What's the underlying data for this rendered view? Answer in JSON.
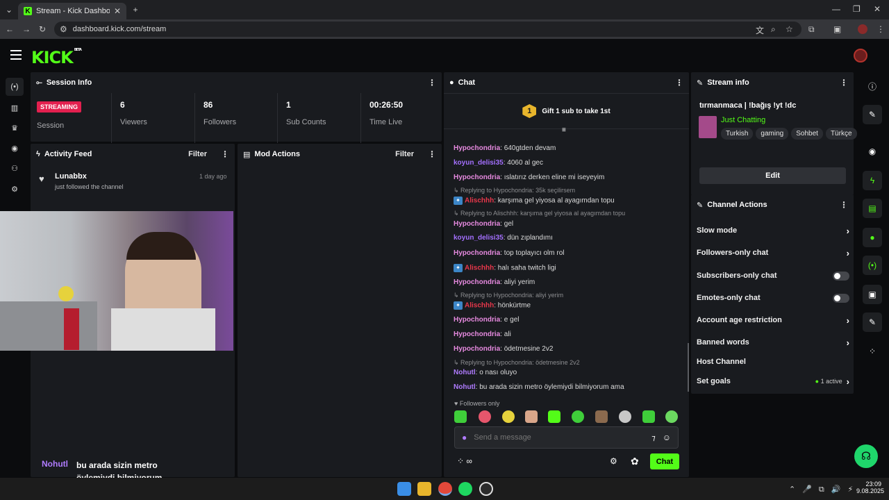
{
  "browser": {
    "tab_title": "Stream - Kick Dashboard",
    "url": "dashboard.kick.com/stream"
  },
  "header": {
    "logo": "KICK",
    "logo_badge": "BETA"
  },
  "session": {
    "title": "Session Info",
    "status_badge": "STREAMING",
    "session_label": "Session",
    "stats": [
      {
        "value": "6",
        "label": "Viewers"
      },
      {
        "value": "86",
        "label": "Followers"
      },
      {
        "value": "1",
        "label": "Sub Counts"
      },
      {
        "value": "00:26:50",
        "label": "Time Live"
      }
    ]
  },
  "activity": {
    "title": "Activity Feed",
    "filter": "Filter",
    "items": [
      {
        "user": "Lunabbx",
        "time": "1 day ago",
        "text": "just followed the channel"
      }
    ]
  },
  "mod": {
    "title": "Mod Actions",
    "filter": "Filter"
  },
  "chat": {
    "title": "Chat",
    "gift_number": "1",
    "gift_text": "Gift 1 sub to take 1st",
    "messages": [
      {
        "user": "Hypochondria",
        "text": "640gtden devam",
        "color": "#e78ae0"
      },
      {
        "user": "koyun_delisi35",
        "text": "4060 al gec",
        "color": "#a470ff"
      },
      {
        "user": "Hypochondria",
        "text": "ıslatırız derken eline mi iseyeyim",
        "color": "#e78ae0"
      },
      {
        "reply": "Replying to Hypochondria: 35k seçilirsem"
      },
      {
        "user": "Alischhh",
        "text": "karşıma gel yiyosa al ayagımdan topu",
        "color": "#e8374b"
      },
      {
        "reply": "Replying to Alischhh: karşıma gel yiyosa al ayagımdan topu"
      },
      {
        "user": "Hypochondria",
        "text": "gel",
        "color": "#e78ae0"
      },
      {
        "user": "koyun_delisi35",
        "text": "dün zıplandımı",
        "color": "#a470ff"
      },
      {
        "user": "Hypochondria",
        "text": "top toplayıcı olm rol",
        "color": "#e78ae0"
      },
      {
        "user": "Alischhh",
        "text": "halı saha twitch ligi",
        "color": "#e8374b"
      },
      {
        "user": "Hypochondria",
        "text": "aliyi yerim",
        "color": "#e78ae0"
      },
      {
        "reply": "Replying to Hypochondria: aliyi yerim"
      },
      {
        "user": "Alischhh",
        "text": "hönkürtme",
        "color": "#e8374b"
      },
      {
        "user": "Hypochondria",
        "text": "e gel",
        "color": "#e78ae0"
      },
      {
        "user": "Hypochondria",
        "text": "ali",
        "color": "#e78ae0"
      },
      {
        "user": "Hypochondria",
        "text": "ödetmesine 2v2",
        "color": "#e78ae0"
      },
      {
        "reply": "Replying to Hypochondria: ödetmesine 2v2"
      },
      {
        "user": "Nohutl",
        "text": "o nası oluyo",
        "color": "#b07cff"
      },
      {
        "user": "Nohutl",
        "text": "bu arada sizin metro öylemiydi bilmiyorum ama",
        "color": "#b07cff"
      }
    ],
    "followers_only": "Followers only",
    "input_placeholder": "Send a message",
    "chat_button": "Chat"
  },
  "stream_info": {
    "title": "Stream info",
    "stream_title": "tırmanmaca | !bağış !yt !dc",
    "category": "Just Chatting",
    "tags": [
      "Turkish",
      "gaming",
      "Sohbet",
      "Türkçe"
    ],
    "edit": "Edit"
  },
  "channel_actions": {
    "title": "Channel Actions",
    "rows": [
      {
        "label": "Slow mode",
        "control": "chevron"
      },
      {
        "label": "Followers-only chat",
        "control": "chevron"
      },
      {
        "label": "Subscribers-only chat",
        "control": "toggle"
      },
      {
        "label": "Emotes-only chat",
        "control": "toggle"
      },
      {
        "label": "Account age restriction",
        "control": "chevron"
      },
      {
        "label": "Banned words",
        "control": "chevron"
      },
      {
        "label": "Host Channel",
        "control": "none"
      },
      {
        "label": "Set goals",
        "control": "chevron",
        "status": "1 active"
      }
    ]
  },
  "overlay_caption": {
    "user": "Nohutl",
    "text": "bu arada sizin metro öylemiydi bilmiyorum ama"
  },
  "taskbar": {
    "time": "23:09",
    "date": "9.08.2025"
  },
  "colors": {
    "kick_green": "#53fc18",
    "streaming_red": "#e3204f",
    "panel": "#191b1f"
  }
}
